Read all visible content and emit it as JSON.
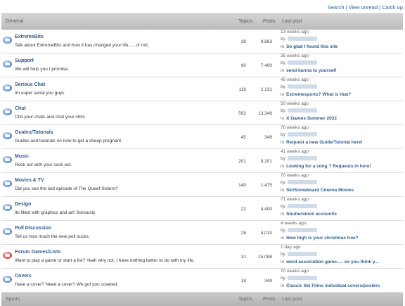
{
  "toplinks": {
    "search": "Search",
    "view_unread": "View unread",
    "catch_up": "Catch up",
    "sep": "|"
  },
  "header": {
    "category": "General",
    "topics": "Topics",
    "posts": "Posts",
    "last_post": "Last post"
  },
  "footer": {
    "category": "Sports",
    "topics": "Topics",
    "posts": "Posts",
    "last_post": "Last post"
  },
  "last_post_prefix": {
    "by": "by",
    "in": "in"
  },
  "forums": [
    {
      "title": "ExtremeBits",
      "desc": "Talk about ExtremeBits and how it has changed your life......or not.",
      "topics": "38",
      "posts": "9,663",
      "when": "13 weeks ago",
      "topic": "So glad I found this site",
      "icon": "blue"
    },
    {
      "title": "Support",
      "desc": "We will help you I promise.",
      "topics": "90",
      "posts": "7,400",
      "when": "35 weeks ago",
      "topic": "send karma to yourself",
      "icon": "blue"
    },
    {
      "title": "Serious Chat",
      "desc": "Im super serial you guys",
      "topics": "116",
      "posts": "2,131",
      "when": "45 weeks ago",
      "topic": "Extremesports? What is that?",
      "icon": "blue"
    },
    {
      "title": "Chat",
      "desc": "Chit your chats and chat your chits",
      "topics": "592",
      "posts": "13,346",
      "when": "50 weeks ago",
      "topic": "X Games Summer 2022",
      "icon": "blue"
    },
    {
      "title": "Guides/Tutorials",
      "desc": "Guides and tutorials on how to get a sheep pregnant.",
      "topics": "45",
      "posts": "349",
      "when": "70 weeks ago",
      "topic": "Request a new Guide/Tutorial here!",
      "icon": "blue"
    },
    {
      "title": "Music",
      "desc": "Rock out with your cock out.",
      "topics": "201",
      "posts": "8,201",
      "when": "41 weeks ago",
      "topic": "Looking for a song ? Requests in here!",
      "icon": "blue"
    },
    {
      "title": "Movies & TV",
      "desc": "Did you see the last episode of The Queef Sisters?",
      "topics": "140",
      "posts": "1,475",
      "when": "70 weeks ago",
      "topic": "Ski/Snowboard Cinema Movies",
      "icon": "blue"
    },
    {
      "title": "Design",
      "desc": "Its filled with graphics and art! Seriously.",
      "topics": "22",
      "posts": "4,400",
      "when": "71 weeks ago",
      "topic": "Shutterstock account/s",
      "icon": "blue"
    },
    {
      "title": "Poll Discussion",
      "desc": "Tell us how much the new poll sucks.",
      "topics": "25",
      "posts": "4,010",
      "when": "4 weeks ago",
      "topic": "How high is your christmas tree?",
      "icon": "blue"
    },
    {
      "title": "Forum Games/Lists",
      "desc": "Want to play a game or start a list? Yeah why not, I have nothing better to do with my life.",
      "topics": "31",
      "posts": "15,088",
      "when": "1 day ago",
      "topic": "word association game..... so you think y...",
      "icon": "red"
    },
    {
      "title": "Covers",
      "desc": "Have a cover? Need a cover? We got you covered.",
      "topics": "18",
      "posts": "349",
      "when": "70 weeks ago",
      "topic": "Classic Ski Films individual covers/posters",
      "icon": "blue"
    }
  ]
}
